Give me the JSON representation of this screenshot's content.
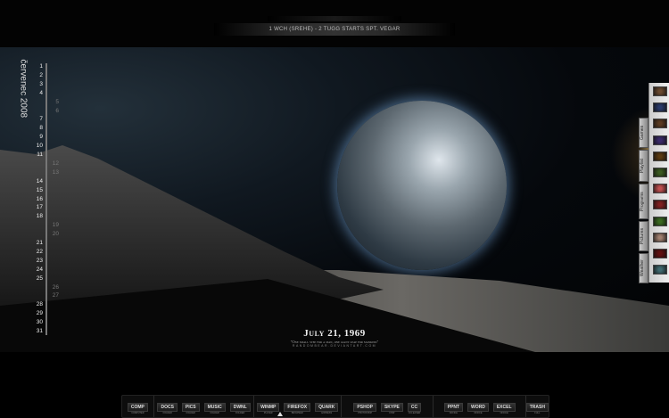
{
  "top_bar": {
    "info": "1 WCH (SREHE) - 2 TUGG STARTS SPT. VEGAR"
  },
  "calendar": {
    "month": "červenec 2008",
    "days": [
      {
        "d": "1",
        "we": false
      },
      {
        "d": "2",
        "we": false
      },
      {
        "d": "3",
        "we": false
      },
      {
        "d": "4",
        "we": false
      },
      {
        "d": "5",
        "we": true
      },
      {
        "d": "6",
        "we": true
      },
      {
        "d": "7",
        "we": false
      },
      {
        "d": "8",
        "we": false
      },
      {
        "d": "9",
        "we": false
      },
      {
        "d": "10",
        "we": false
      },
      {
        "d": "11",
        "we": false
      },
      {
        "d": "12",
        "we": true
      },
      {
        "d": "13",
        "we": true
      },
      {
        "d": "14",
        "we": false
      },
      {
        "d": "15",
        "we": false
      },
      {
        "d": "16",
        "we": false
      },
      {
        "d": "17",
        "we": false
      },
      {
        "d": "18",
        "we": false
      },
      {
        "d": "19",
        "we": true
      },
      {
        "d": "20",
        "we": true
      },
      {
        "d": "21",
        "we": false
      },
      {
        "d": "22",
        "we": false
      },
      {
        "d": "23",
        "we": false
      },
      {
        "d": "24",
        "we": false
      },
      {
        "d": "25",
        "we": false
      },
      {
        "d": "26",
        "we": true
      },
      {
        "d": "27",
        "we": true
      },
      {
        "d": "28",
        "we": false
      },
      {
        "d": "29",
        "we": false
      },
      {
        "d": "30",
        "we": false
      },
      {
        "d": "31",
        "we": false
      }
    ]
  },
  "wallpaper": {
    "date": "July 21, 1969",
    "quote": "\"One small step for a man, one giant leap for mankind\"",
    "credit": "RANDOMBEAR.DEVIANTART.COM"
  },
  "side_tabs": [
    "Games",
    "Playlist",
    "Programs",
    "Pictures",
    "Weather"
  ],
  "thumb_colors": [
    "#6a4a30",
    "#2a3a6a",
    "#5a3a20",
    "#3a2a6a",
    "#5a3a10",
    "#3a5a20",
    "#c05050",
    "#802020",
    "#3a6a20",
    "#a08070",
    "#601010",
    "#406a70"
  ],
  "dock": {
    "groups": [
      [
        {
          "label": "COMP",
          "sub": "COMPUTER"
        }
      ],
      [
        {
          "label": "DOCS",
          "sub": "FOLDER"
        },
        {
          "label": "PICS",
          "sub": "FOLDER"
        },
        {
          "label": "MUSIC",
          "sub": "FOLDER"
        },
        {
          "label": "DWNL",
          "sub": "FOLDER"
        }
      ],
      [
        {
          "label": "WINMP",
          "sub": "PLAYER"
        },
        {
          "label": "FIREFOX",
          "sub": "BROWSER"
        },
        {
          "label": "QUARK",
          "sub": "EXPRESS"
        }
      ],
      [
        {
          "label": "PSHOP",
          "sub": "PHOTOSHOP"
        },
        {
          "label": "SKYPE",
          "sub": "CHAT"
        },
        {
          "label": "CC",
          "sub": "CCLEANER"
        }
      ],
      [
        {
          "label": "PPNT",
          "sub": "OFFICE"
        },
        {
          "label": "WORD",
          "sub": "OFFICE"
        },
        {
          "label": "EXCEL",
          "sub": "OFFICE"
        }
      ],
      [
        {
          "label": "TRASH",
          "sub": "FULL"
        }
      ]
    ]
  }
}
